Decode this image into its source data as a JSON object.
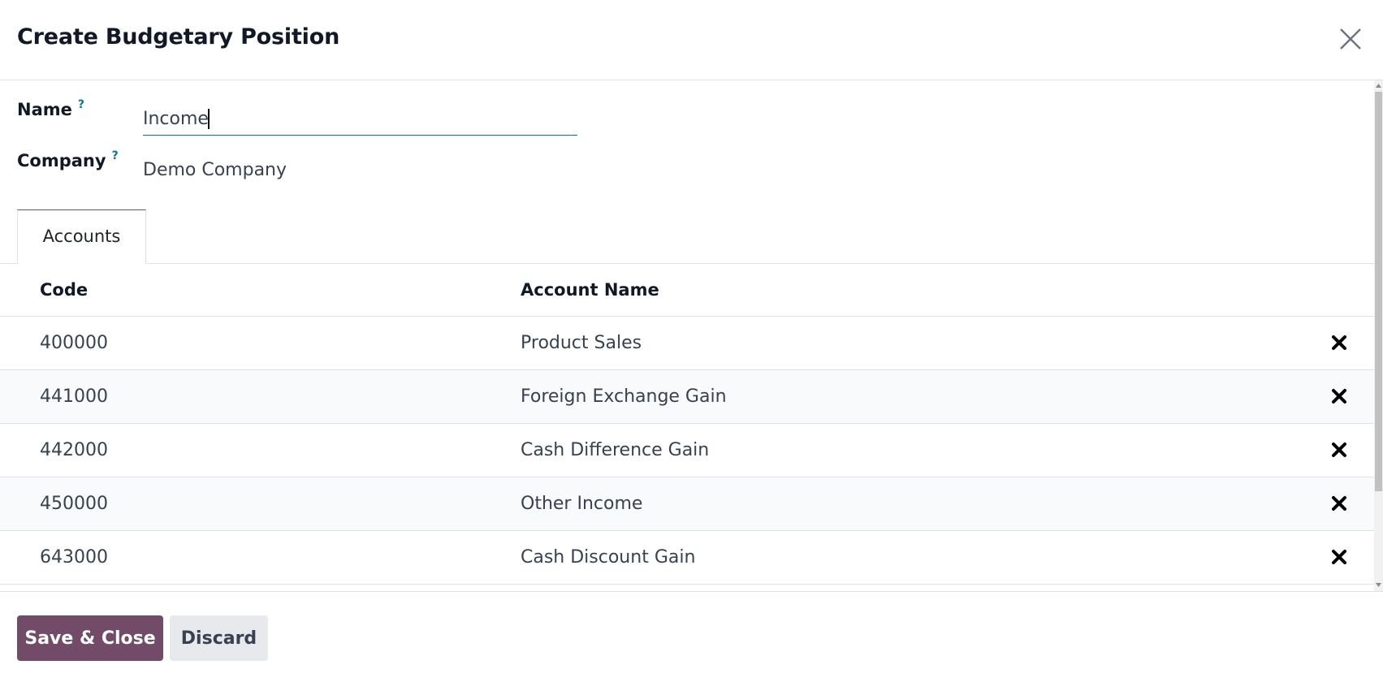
{
  "dialog": {
    "title": "Create Budgetary Position",
    "close_icon": "close-icon"
  },
  "form": {
    "name_label": "Name",
    "name_help": "?",
    "name_value": "Income",
    "company_label": "Company",
    "company_help": "?",
    "company_value": "Demo Company"
  },
  "tabs": [
    {
      "label": "Accounts",
      "active": true
    }
  ],
  "table": {
    "columns": [
      "Code",
      "Account Name"
    ],
    "rows": [
      {
        "code": "400000",
        "name": "Product Sales"
      },
      {
        "code": "441000",
        "name": "Foreign Exchange Gain"
      },
      {
        "code": "442000",
        "name": "Cash Difference Gain"
      },
      {
        "code": "450000",
        "name": "Other Income"
      },
      {
        "code": "643000",
        "name": "Cash Discount Gain"
      }
    ],
    "row_action_icon": "delete-x-icon"
  },
  "footer": {
    "save_label": "Save & Close",
    "discard_label": "Discard"
  },
  "colors": {
    "primary": "#714b67",
    "secondary_bg": "#e7e9ed",
    "help_accent": "#017e84",
    "input_underline": "#017e84"
  }
}
